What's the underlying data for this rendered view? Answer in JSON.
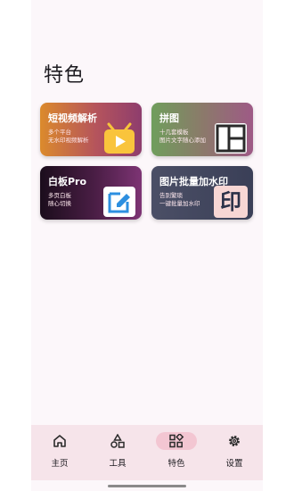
{
  "page": {
    "title": "特色"
  },
  "cards": [
    {
      "title": "短视频解析",
      "line1": "多个平台",
      "line2": "无水印视频解析"
    },
    {
      "title": "拼图",
      "line1": "十几套模板",
      "line2": "图片文字随心添加"
    },
    {
      "title": "白板Pro",
      "line1": "多页白板",
      "line2": "随心切换"
    },
    {
      "title": "图片批量加水印",
      "line1": "告别繁琐",
      "line2": "一键批量加水印",
      "badge": "印"
    }
  ],
  "nav": {
    "items": [
      {
        "label": "主页",
        "icon": "home-icon"
      },
      {
        "label": "工具",
        "icon": "shapes-icon"
      },
      {
        "label": "特色",
        "icon": "widgets-icon",
        "active": true
      },
      {
        "label": "设置",
        "icon": "gear-icon"
      }
    ]
  },
  "colors": {
    "nav_bg": "#f6e4ea",
    "nav_active": "#f3c6d2",
    "page_bg": "#fcf7fa"
  }
}
